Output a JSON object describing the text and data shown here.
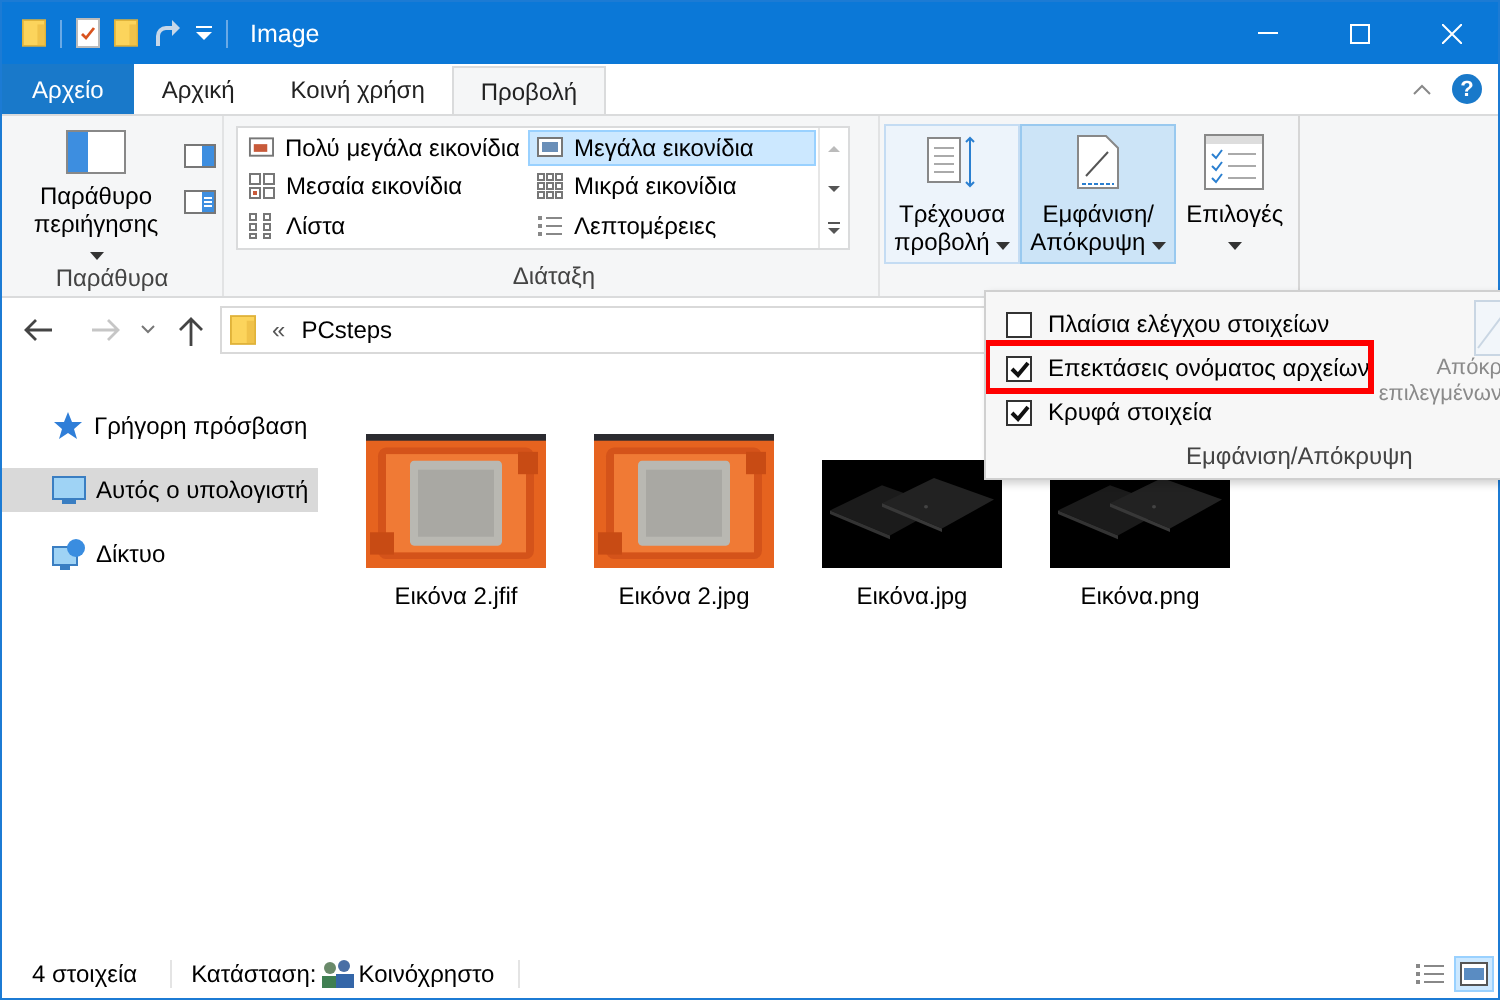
{
  "window": {
    "title": "Image"
  },
  "ribbon_tabs": [
    {
      "label": "Αρχείο",
      "kind": "file",
      "selected": false
    },
    {
      "label": "Αρχική",
      "kind": "tab",
      "selected": false
    },
    {
      "label": "Κοινή χρήση",
      "kind": "tab",
      "selected": false
    },
    {
      "label": "Προβολή",
      "kind": "tab",
      "selected": true
    }
  ],
  "help": "?",
  "ribbon": {
    "panes": {
      "button_lines": [
        "Παράθυρο",
        "περιήγησης"
      ],
      "group": "Παράθυρα"
    },
    "layout": {
      "group": "Διάταξη",
      "options": [
        {
          "label": "Πολύ μεγάλα εικονίδια",
          "kind": "extra-large",
          "selected": false
        },
        {
          "label": "Μεγάλα εικονίδια",
          "kind": "large",
          "selected": true
        },
        {
          "label": "Μεσαία εικονίδια",
          "kind": "medium",
          "selected": false
        },
        {
          "label": "Μικρά εικονίδια",
          "kind": "small",
          "selected": false
        },
        {
          "label": "Λίστα",
          "kind": "list",
          "selected": false
        },
        {
          "label": "Λεπτομέρειες",
          "kind": "details",
          "selected": false
        }
      ]
    },
    "current_view": {
      "lines": [
        "Τρέχουσα",
        "προβολή"
      ]
    },
    "show_hide": {
      "lines": [
        "Εμφάνιση/",
        "Απόκρυψη"
      ],
      "expanded": true
    },
    "options": {
      "lines": [
        "Επιλογές"
      ]
    }
  },
  "address": {
    "overflow": "«",
    "path": "PCsteps"
  },
  "sidebar": [
    {
      "label": "Γρήγορη πρόσβαση",
      "kind": "quick",
      "selected": false
    },
    {
      "label": "Αυτός ο υπολογιστή",
      "kind": "pc",
      "selected": true
    },
    {
      "label": "Δίκτυο",
      "kind": "network",
      "selected": false
    }
  ],
  "files": [
    {
      "name": "Εικόνα 2.jfif",
      "kind": "picture"
    },
    {
      "name": "Εικόνα 2.jpg",
      "kind": "picture"
    },
    {
      "name": "Εικόνα.jpg",
      "kind": "picture"
    },
    {
      "name": "Εικόνα.png",
      "kind": "picture"
    }
  ],
  "menu": {
    "items": [
      {
        "label": "Πλαίσια ελέγχου στοιχείων",
        "checked": false,
        "highlighted": false
      },
      {
        "label": "Επεκτάσεις ονόματος αρχείων",
        "checked": true,
        "highlighted": true
      },
      {
        "label": "Κρυφά στοιχεία",
        "checked": true,
        "highlighted": false
      }
    ],
    "hide_selected": {
      "lines": [
        "Απόκρ",
        "επιλεγμένων"
      ],
      "disabled": true
    },
    "group": "Εμφάνιση/Απόκρυψη"
  },
  "status_bar": {
    "count": "4 στοιχεία",
    "state_label": "Κατάσταση:",
    "state_value": "Κοινόχρηστο",
    "view_buttons": [
      {
        "kind": "details",
        "selected": false
      },
      {
        "kind": "large-icons",
        "selected": true
      }
    ]
  }
}
